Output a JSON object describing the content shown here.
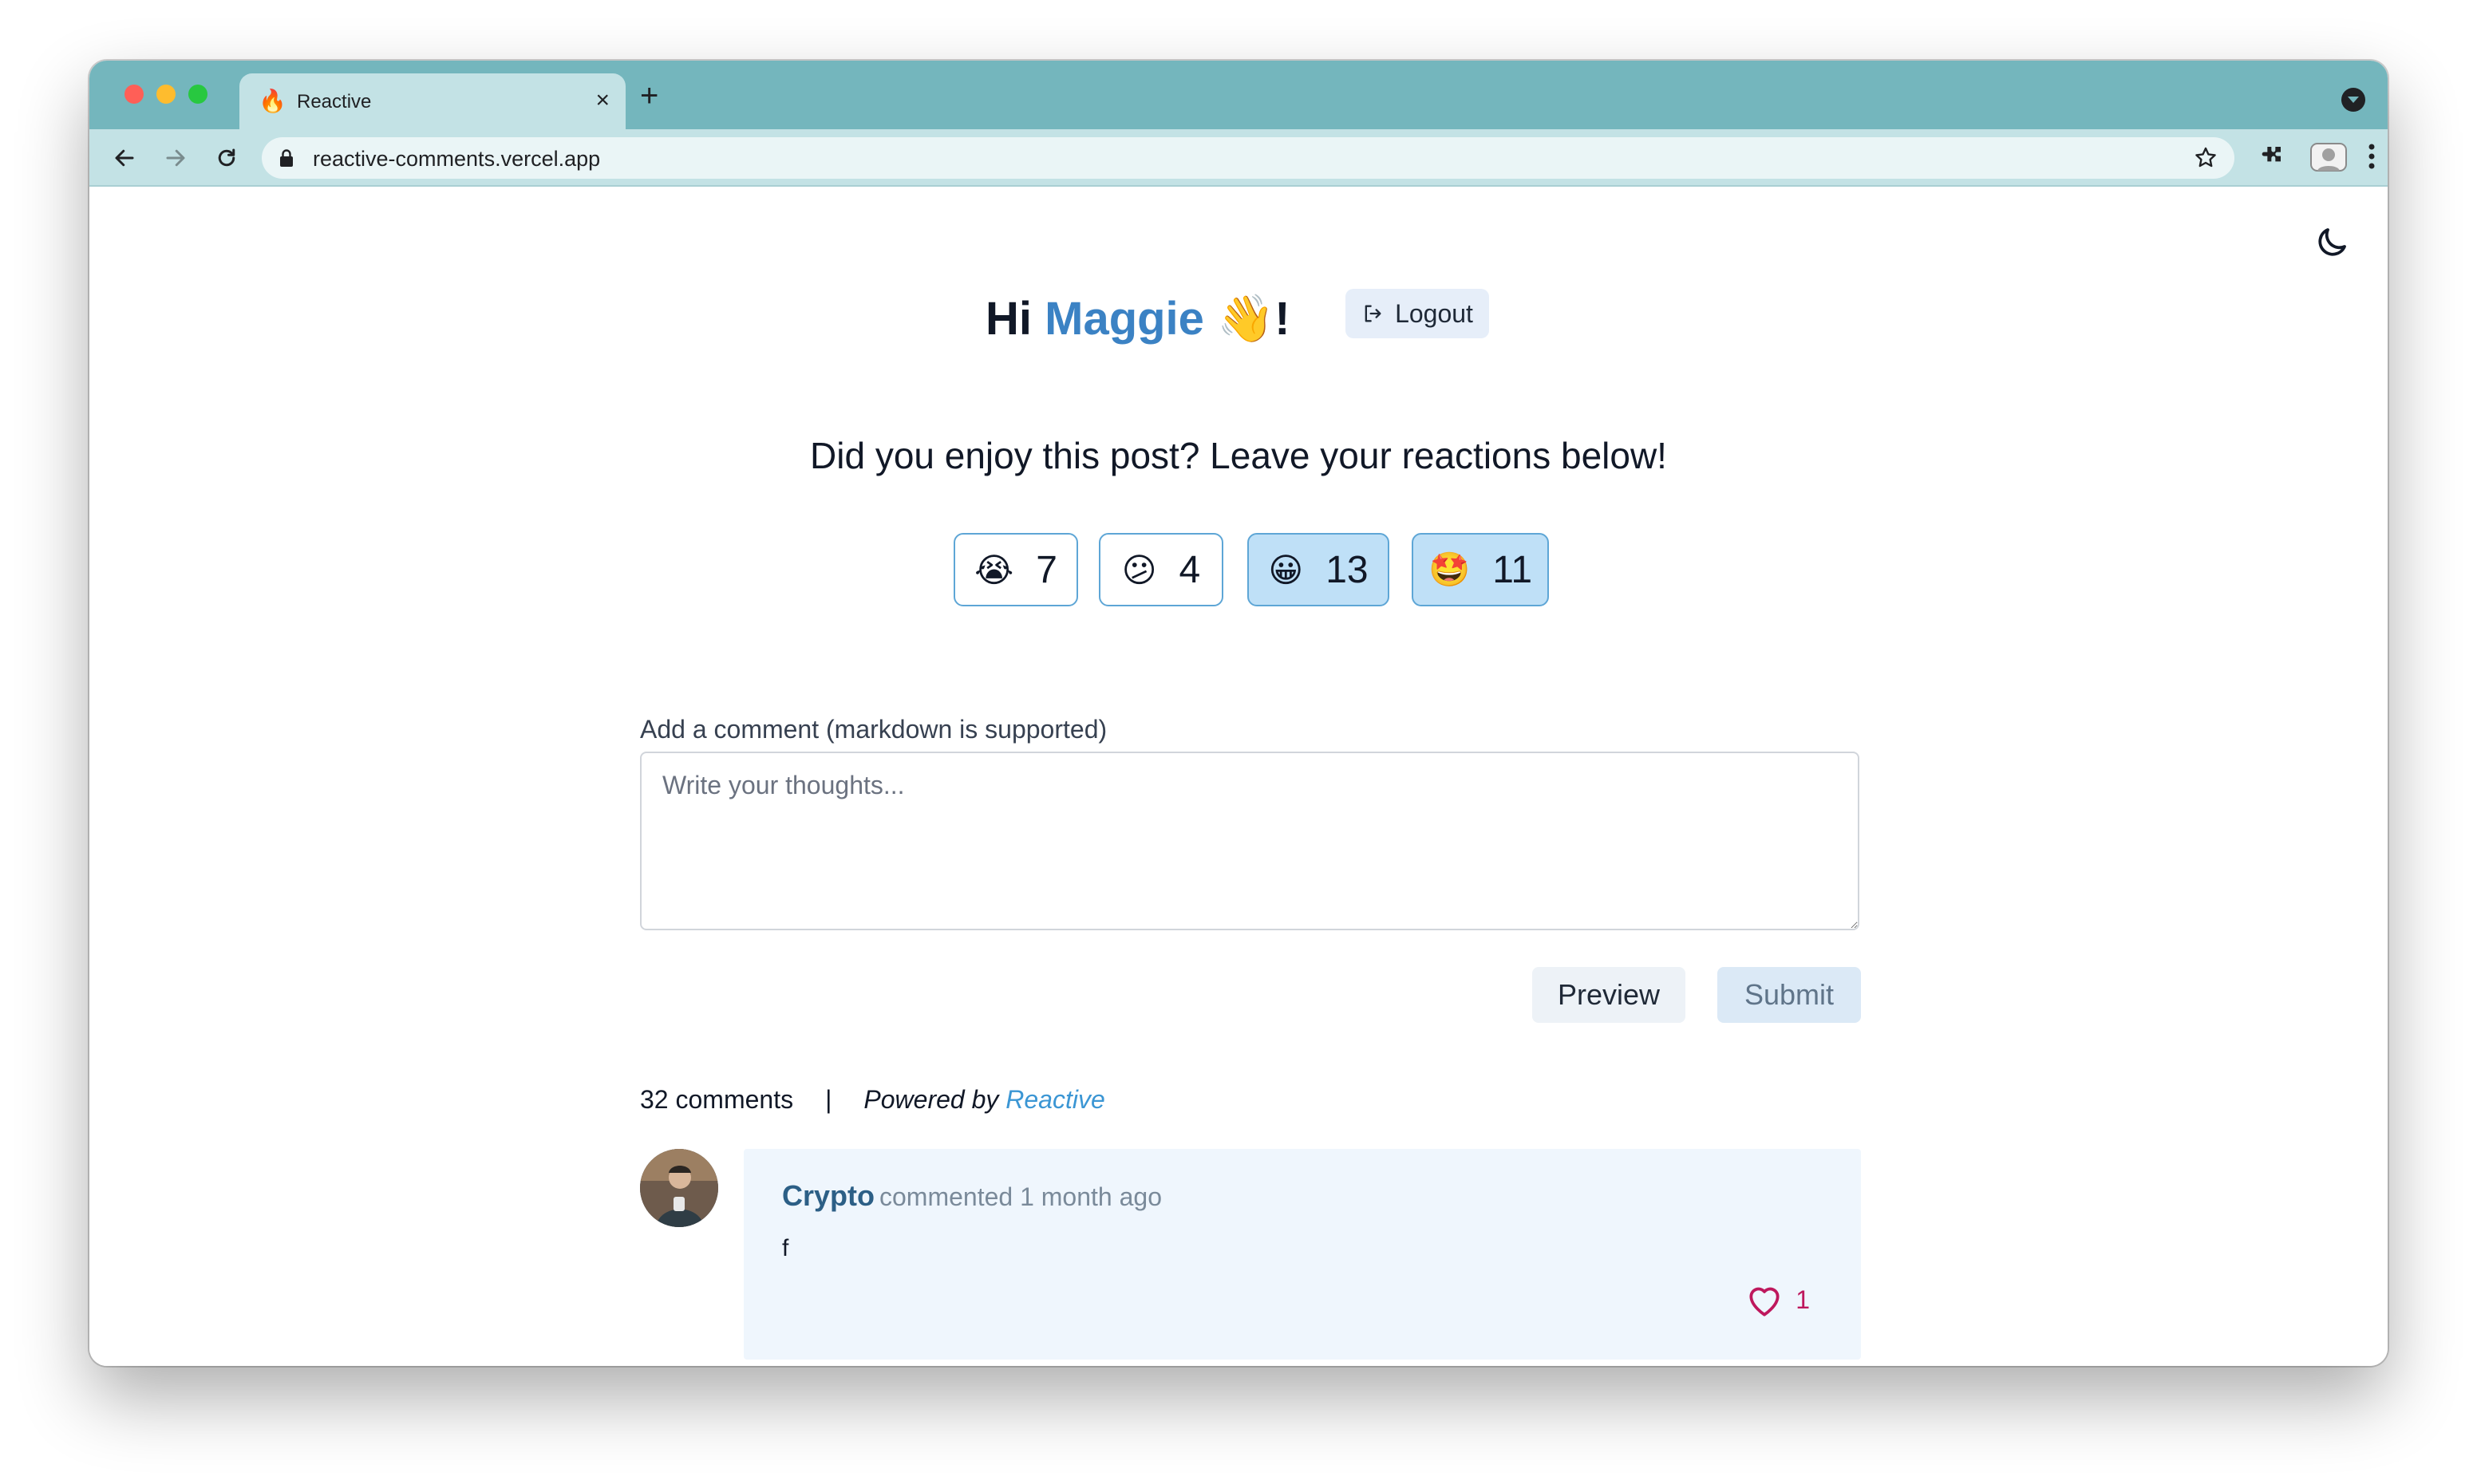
{
  "browser": {
    "tab_title": "Reactive",
    "tab_favicon": "🔥",
    "url": "reactive-comments.vercel.app"
  },
  "header": {
    "greeting_prefix": "Hi ",
    "user_name": "Maggie",
    "greeting_suffix": " 👋!",
    "logout_label": "Logout",
    "question": "Did you enjoy this post? Leave your reactions below!"
  },
  "reactions": [
    {
      "emoji": "😭",
      "count": "7",
      "selected": false
    },
    {
      "emoji": "😕",
      "count": "4",
      "selected": false
    },
    {
      "emoji": "😀",
      "count": "13",
      "selected": true
    },
    {
      "emoji": "🤩",
      "count": "11",
      "selected": true
    }
  ],
  "comment_form": {
    "label": "Add a comment (markdown is supported)",
    "placeholder": "Write your thoughts...",
    "value": "",
    "preview_label": "Preview",
    "submit_label": "Submit"
  },
  "comments_meta": {
    "count_label": "32 comments",
    "separator": "|",
    "powered_by": "Powered by",
    "brand": "Reactive"
  },
  "comments": [
    {
      "author": "Crypto",
      "meta": "commented 1 month ago",
      "body": "f",
      "likes": "1"
    }
  ],
  "colors": {
    "chrome_titlebar": "#74b6bd",
    "chrome_toolbar": "#c3e2e5",
    "accent_name": "#3b82c4",
    "reaction_border": "#5ea6d6",
    "reaction_selected_bg": "#bfe0f7",
    "like_color": "#be185d",
    "comment_card_bg": "#eff6fd"
  },
  "icons": [
    "back-arrow-icon",
    "forward-arrow-icon",
    "reload-icon",
    "lock-icon",
    "star-icon",
    "extensions-icon",
    "profile-icon",
    "kebab-menu-icon",
    "moon-icon",
    "logout-icon",
    "heart-icon"
  ]
}
